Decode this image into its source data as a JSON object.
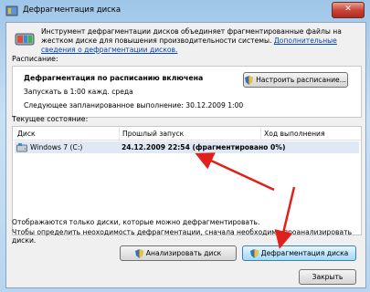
{
  "window": {
    "title": "Дефрагментация диска",
    "close_label": "✕"
  },
  "intro": {
    "text": "Инструмент дефрагментации дисков объединяет фрагментированные файлы на жестком диске для повышения производительности системы.",
    "link": "Дополнительные сведения о дефрагментации дисков."
  },
  "schedule": {
    "section_label": "Расписание:",
    "status": "Дефрагментация по расписанию включена",
    "run_at": "Запускать в 1:00 кажд. среда",
    "next_run": "Следующее запланированное выполнение: 30.12.2009 1:00",
    "configure_button": "Настроить расписание..."
  },
  "current_state": {
    "section_label": "Текущее состояние:",
    "columns": [
      "Диск",
      "Прошлый запуск",
      "Ход выполнения"
    ],
    "rows": [
      {
        "disk": "Windows 7 (C:)",
        "last_run": "24.12.2009 22:54 (фрагментировано 0%)",
        "progress": ""
      }
    ]
  },
  "footer": {
    "line1": "Отображаются только диски, которые можно дефрагментировать.",
    "line2": "Чтобы определить неоходимость  дефрагментации, сначала необходимо проанализировать диски.",
    "analyze_button": "Анализировать диск",
    "defrag_button": "Дефрагментация диска",
    "close_button": "Закрыть"
  },
  "colors": {
    "annotation_arrow": "#e0201a",
    "link": "#0645ad"
  }
}
